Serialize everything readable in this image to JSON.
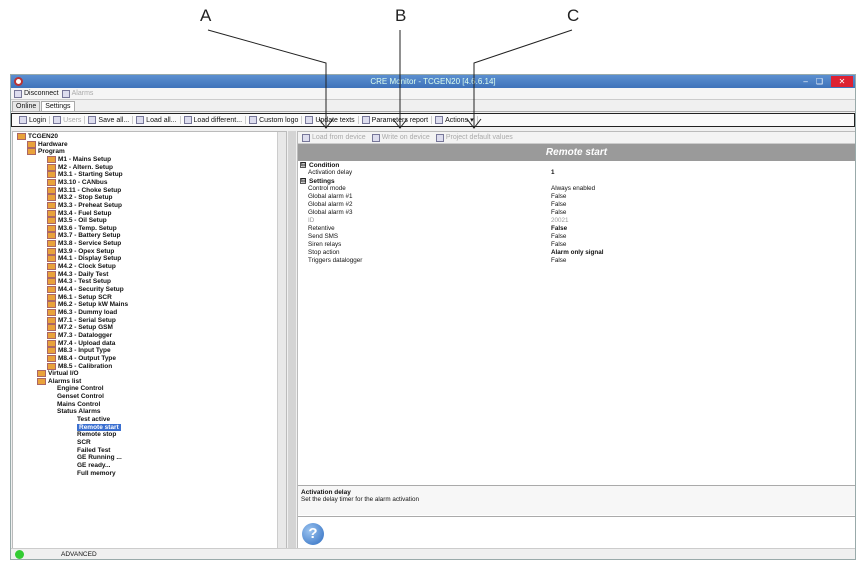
{
  "callouts": {
    "a": "A",
    "b": "B",
    "c": "C"
  },
  "window": {
    "title": "CRE Monitor - TCGEN20 [4.6.6.14]"
  },
  "menu": {
    "disconnect": "Disconnect",
    "alarms": "Alarms"
  },
  "tabs": {
    "online": "Online",
    "settings": "Settings"
  },
  "toolbar": {
    "login": "Login",
    "users": "Users",
    "save_all": "Save all...",
    "load_all": "Load all...",
    "load_different": "Load different...",
    "custom_logo": "Custom logo",
    "update_texts": "Update texts",
    "param_report": "Parameters report",
    "actions": "Actions"
  },
  "tree": {
    "root": "TCGEN20",
    "hardware": "Hardware",
    "program": "Program",
    "items": [
      "M1 - Mains Setup",
      "M2 - Altern. Setup",
      "M3.1 - Starting Setup",
      "M3.10 - CANbus",
      "M3.11 - Choke Setup",
      "M3.2 - Stop Setup",
      "M3.3 - Preheat Setup",
      "M3.4 - Fuel Setup",
      "M3.5 - Oil Setup",
      "M3.6 - Temp. Setup",
      "M3.7 - Battery Setup",
      "M3.8 - Service Setup",
      "M3.9 - Opex Setup",
      "M4.1 - Display Setup",
      "M4.2 - Clock Setup",
      "M4.3 - Daily Test",
      "M4.3 - Test Setup",
      "M4.4 - Security Setup",
      "M6.1 - Setup SCR",
      "M6.2 - Setup kW Mains",
      "M6.3 - Dummy load",
      "M7.1 - Serial Setup",
      "M7.2 - Setup GSM",
      "M7.3 - Datalogger",
      "M7.4 - Upload data",
      "M8.3 - Input Type",
      "M8.4 - Output Type",
      "M8.5 - Calibration"
    ],
    "virtual_io": "Virtual I/O",
    "alarms_list": "Alarms list",
    "alarm_groups": [
      "Engine Control",
      "Genset Control",
      "Mains Control",
      "Status Alarms"
    ],
    "status_alarms": [
      "Test active",
      "Remote start",
      "Remote stop",
      "SCR",
      "Failed Test",
      "GE Running ...",
      "GE ready...",
      "Full memory"
    ]
  },
  "right_toolbar": {
    "load_from_device": "Load from device",
    "write_on_device": "Write on device",
    "project_defaults": "Project default values"
  },
  "panel": {
    "title": "Remote start"
  },
  "groups": {
    "condition": "Condition",
    "settings": "Settings",
    "collapse": "⊟"
  },
  "props": [
    {
      "k": "Activation delay",
      "v": "1",
      "bold": true
    },
    {
      "k": "Control mode",
      "v": "Always enabled"
    },
    {
      "k": "Global alarm #1",
      "v": "False"
    },
    {
      "k": "Global alarm #2",
      "v": "False"
    },
    {
      "k": "Global alarm #3",
      "v": "False"
    },
    {
      "k": "ID",
      "v": "20021",
      "gray": true
    },
    {
      "k": "Retentive",
      "v": "False",
      "bold": true
    },
    {
      "k": "Send SMS",
      "v": "False"
    },
    {
      "k": "Siren relays",
      "v": "False"
    },
    {
      "k": "Stop action",
      "v": "Alarm only signal",
      "bold": true
    },
    {
      "k": "Triggers datalogger",
      "v": "False"
    }
  ],
  "description": {
    "title": "Activation delay",
    "text": "Set the delay timer for the alarm activation"
  },
  "help": {
    "glyph": "?"
  },
  "status": {
    "text": "ADVANCED",
    "color": "#33cc33"
  }
}
